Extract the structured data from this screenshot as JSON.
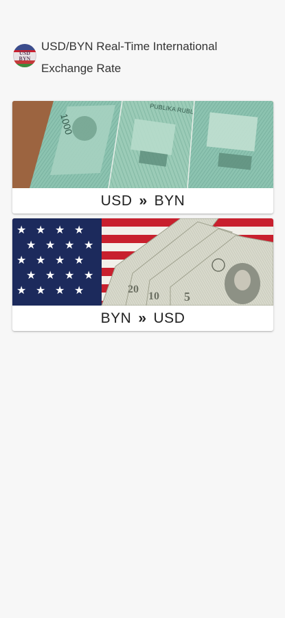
{
  "header": {
    "logo_lines": [
      "USD",
      "BYN"
    ],
    "title_line1": "USD/BYN Real-Time International",
    "title_line2": "Exchange Rate"
  },
  "cards": [
    {
      "from": "USD",
      "separator": "»",
      "to": "BYN",
      "image": "belarusian-ruble-banknotes"
    },
    {
      "from": "BYN",
      "separator": "»",
      "to": "USD",
      "image": "us-flag-with-dollar-bills"
    }
  ],
  "colors": {
    "background": "#f7f7f7",
    "card": "#ffffff",
    "flag_blue": "#1c2a5c",
    "flag_red": "#c8202e",
    "banknote_green": "#7fb8a4",
    "table_wood": "#b07850"
  }
}
